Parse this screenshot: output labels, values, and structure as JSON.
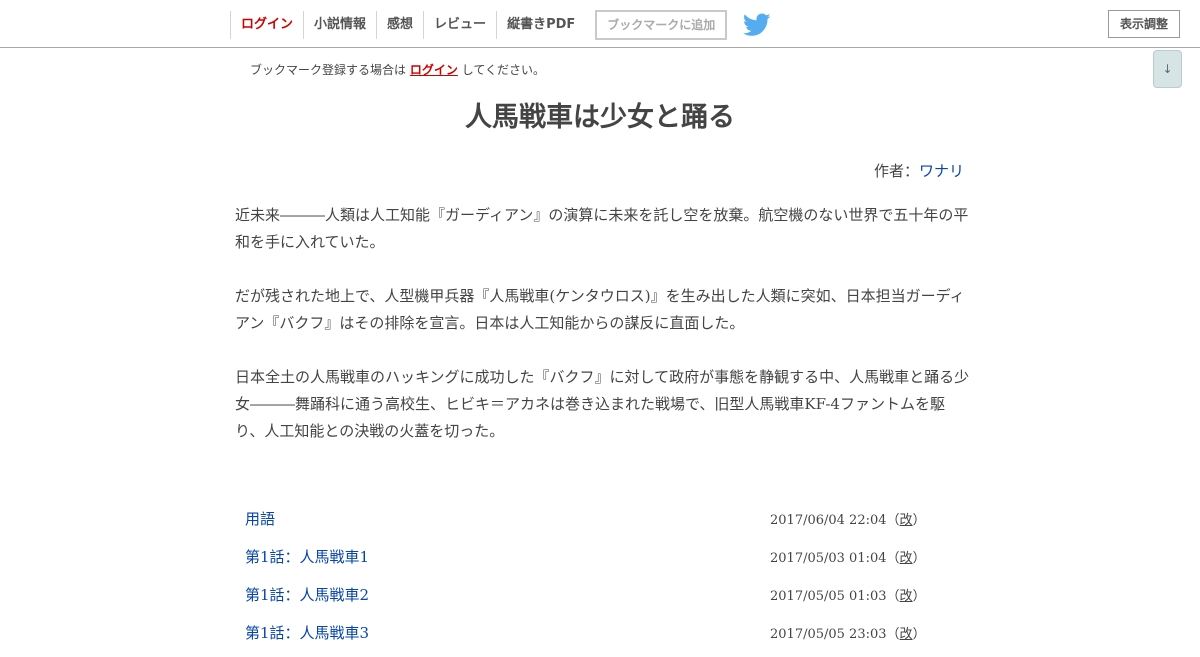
{
  "nav": {
    "login": "ログイン",
    "novel_info": "小説情報",
    "impressions": "感想",
    "review": "レビュー",
    "vertical_pdf": "縦書きPDF",
    "bookmark_add": "ブックマークに追加",
    "twitter_icon": "twitter-bird-icon",
    "display_settings": "表示調整"
  },
  "scroll_down": "↓",
  "notice": {
    "before": "ブックマーク登録する場合は",
    "link": "ログイン",
    "after": "してください。"
  },
  "title": "人馬戦車は少女と踊る",
  "author": {
    "label": "作者：",
    "name": "ワナリ"
  },
  "synopsis": [
    "近未来―――人類は人工知能『ガーディアン』の演算に未来を託し空を放棄。航空機のない世界で五十年の平和を手に入れていた。",
    "だが残された地上で、人型機甲兵器『人馬戦車(ケンタウロス)』を生み出した人類に突如、日本担当ガーディアン『バクフ』はその排除を宣言。日本は人工知能からの謀反に直面した。",
    "日本全土の人馬戦車のハッキングに成功した『バクフ』に対して政府が事態を静観する中、人馬戦車と踊る少女―――舞踊科に通う高校生、ヒビキ＝アカネは巻き込まれた戦場で、旧型人馬戦車KF-4ファントムを駆り、人工知能との決戦の火蓋を切った。"
  ],
  "index": [
    {
      "title": "用語",
      "date": "2017/06/04 22:04",
      "rev_open": "（",
      "rev": "改",
      "rev_close": "）"
    },
    {
      "title": "第1話：人馬戦車1",
      "date": "2017/05/03 01:04",
      "rev_open": "（",
      "rev": "改",
      "rev_close": "）"
    },
    {
      "title": "第1話：人馬戦車2",
      "date": "2017/05/05 01:03",
      "rev_open": "（",
      "rev": "改",
      "rev_close": "）"
    },
    {
      "title": "第1話：人馬戦車3",
      "date": "2017/05/05 23:03",
      "rev_open": "（",
      "rev": "改",
      "rev_close": "）"
    }
  ],
  "colors": {
    "link": "#0645ad",
    "accent_red": "#cc0000",
    "text": "#444444",
    "twitter": "#55acee"
  }
}
